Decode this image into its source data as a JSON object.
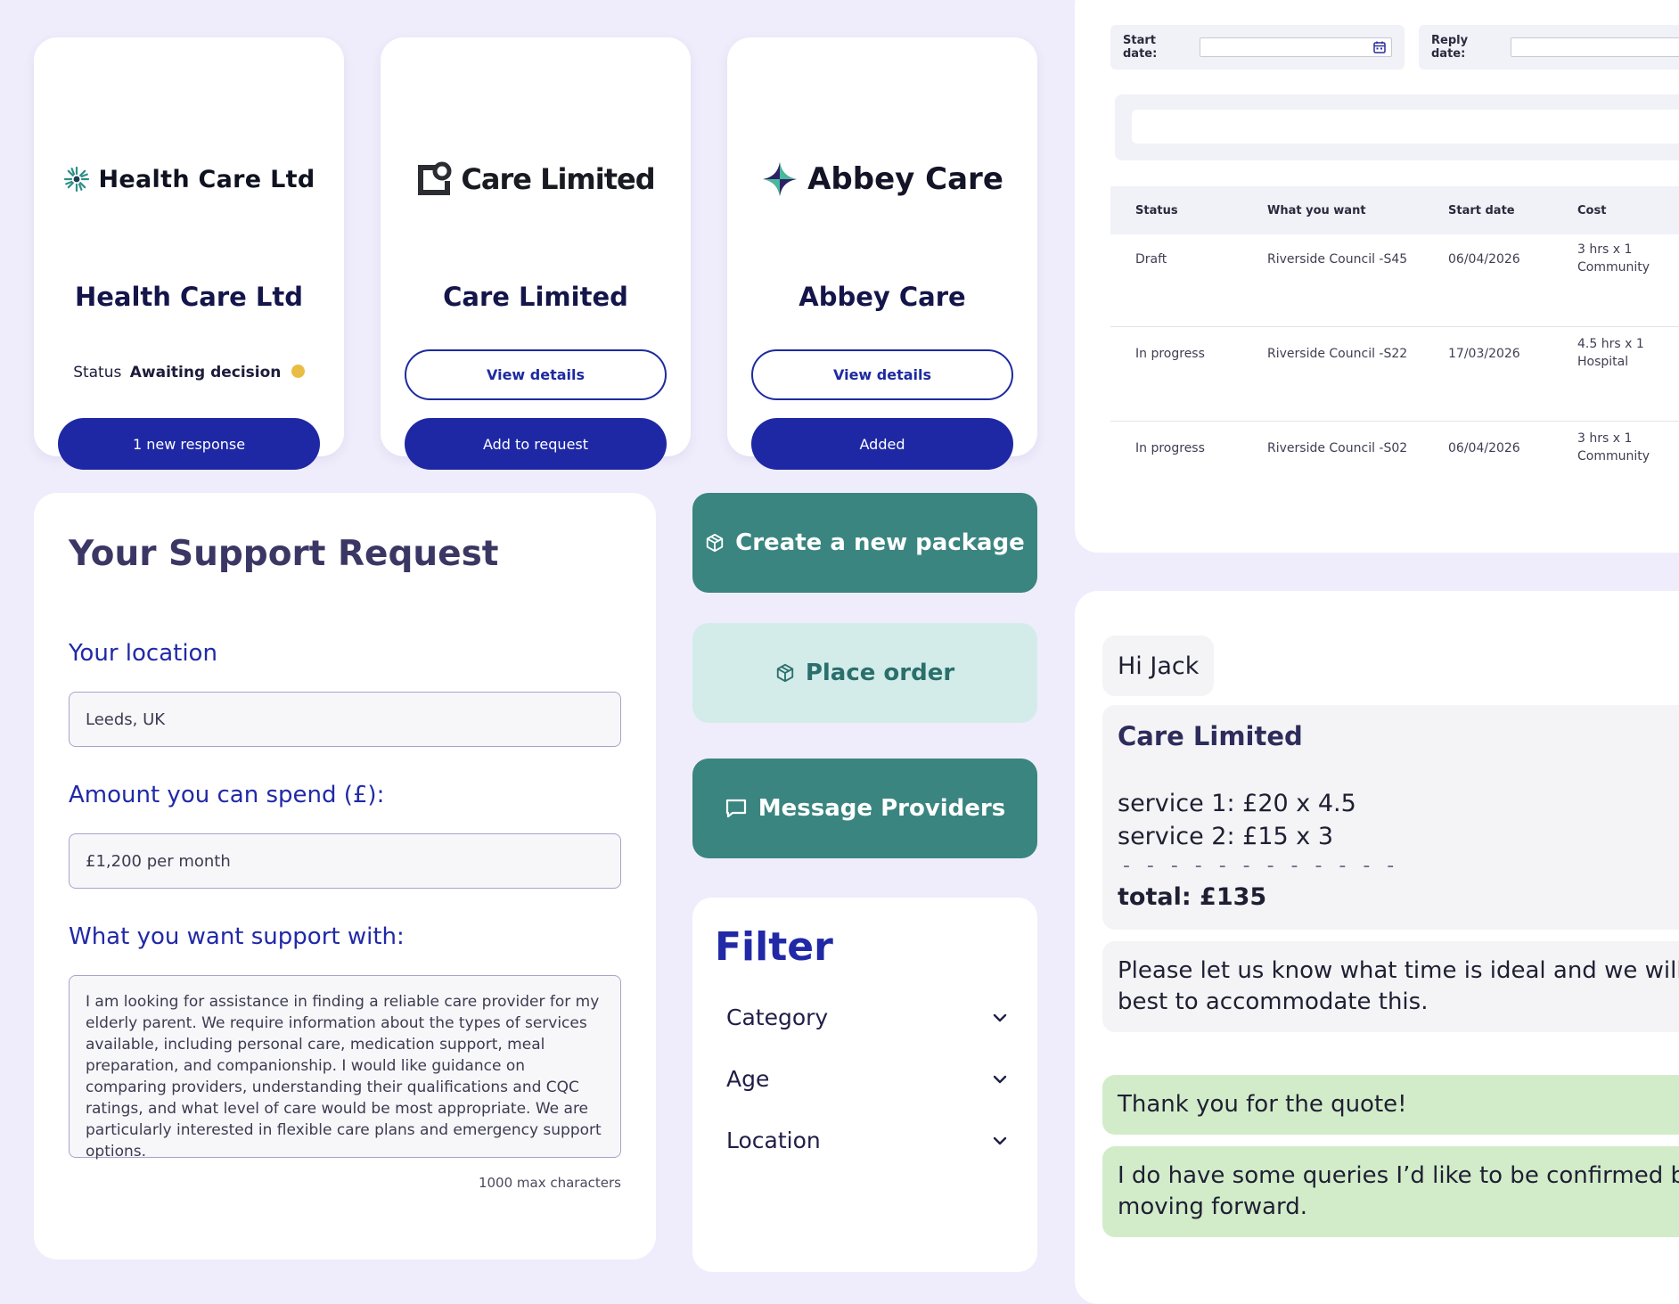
{
  "providers": [
    {
      "logo_text": "Health Care Ltd",
      "name": "Health Care Ltd",
      "status_label": "Status",
      "status_value": "Awaiting decision",
      "status_color": "#e9bd43",
      "primary_button": "1 new response"
    },
    {
      "logo_text": "Care Limited",
      "name": "Care Limited",
      "secondary_button": "View details",
      "primary_button": "Add to request"
    },
    {
      "logo_text": "Abbey Care",
      "name": "Abbey Care",
      "secondary_button": "View details",
      "primary_button": "Added"
    }
  ],
  "support_request": {
    "title": "Your Support Request",
    "location_label": "Your location",
    "location_value": "Leeds, UK",
    "amount_label": "Amount you can spend (£):",
    "amount_value": "£1,200 per month",
    "support_label": "What you want support with:",
    "support_text": "I am looking for assistance in finding a reliable care provider for my elderly parent. We require information about the types of services available, including personal care, medication support, meal preparation, and companionship. I would like guidance on comparing providers, understanding their qualifications and CQC ratings, and what level of care would be most appropriate. We are particularly interested in flexible care plans and emergency support options.",
    "char_hint": "1000 max characters"
  },
  "actions": {
    "create_package": "Create a new package",
    "place_order": "Place order",
    "message_providers": "Message Providers"
  },
  "filter": {
    "title": "Filter",
    "options": [
      "Category",
      "Age",
      "Location"
    ]
  },
  "requests_table": {
    "start_date_label": "Start date:",
    "reply_date_label": "Reply date:",
    "columns": [
      "Status",
      "What you want",
      "Start date",
      "Cost"
    ],
    "rows": [
      {
        "status": "Draft",
        "what": "Riverside Council -S45",
        "start": "06/04/2026",
        "cost_line1": "3 hrs x 1",
        "cost_line2": "Community"
      },
      {
        "status": "In progress",
        "what": "Riverside Council -S22",
        "start": "17/03/2026",
        "cost_line1": "4.5 hrs x 1",
        "cost_line2": "Hospital"
      },
      {
        "status": "In progress",
        "what": "Riverside Council  -S02",
        "start": "06/04/2026",
        "cost_line1": "3 hrs x 1",
        "cost_line2": "Community"
      }
    ]
  },
  "chat": {
    "greeting": "Hi Jack",
    "quote_provider": "Care Limited",
    "quote_line1": "service 1: £20 x 4.5",
    "quote_line2": "service 2: £15 x 3",
    "quote_divider": "- - - - - - - - - - - -",
    "quote_total": "total: £135",
    "message_line1": "Please let us know what time is ideal and we will try ou",
    "message_line2": "best to accommodate this.",
    "reply1": "Thank you for the quote!",
    "reply2_line1": "I do have some queries I’d like to be confirmed before",
    "reply2_line2": "moving forward."
  },
  "colors": {
    "background": "#efedfb",
    "brand_blue": "#1e28a4",
    "teal": "#3a8580",
    "teal_light": "#d3ecea",
    "reply_green": "#d2ecc9"
  }
}
